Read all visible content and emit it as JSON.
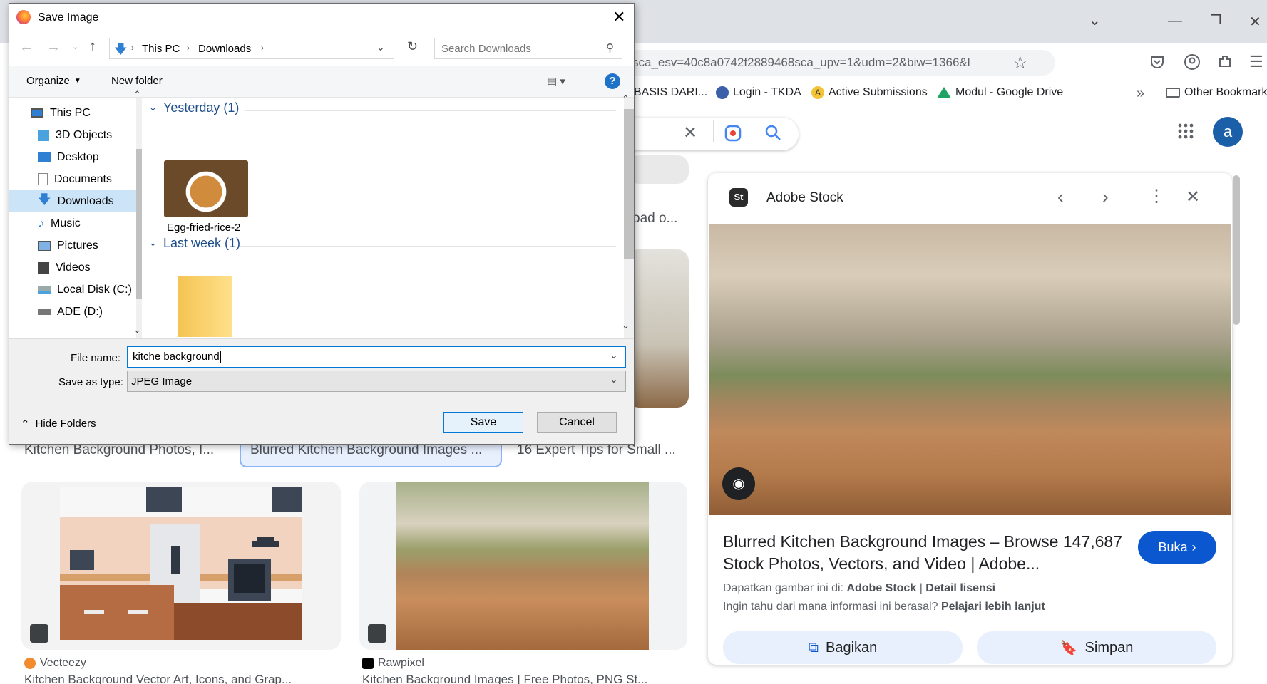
{
  "browser": {
    "url": "sca_esv=40c8a0742f2889468sca_upv=1&udm=2&biw=1366&l",
    "bookmarks": [
      {
        "label": "BASIS DARI..."
      },
      {
        "label": "Login - TKDA"
      },
      {
        "label": "Active Submissions"
      },
      {
        "label": "Modul - Google Drive"
      },
      {
        "label": "Other Bookmarks"
      }
    ],
    "avatar_letter": "a"
  },
  "results": {
    "top_partial_caption": "oad o...",
    "captions": [
      "Kitchen Background Photos, I...",
      "Blurred Kitchen Background Images ...",
      "16 Expert Tips for Small ..."
    ],
    "sources": [
      {
        "name": "Vecteezy",
        "title": "Kitchen Background Vector Art, Icons, and Grap..."
      },
      {
        "name": "Rawpixel",
        "title": "Kitchen Background Images | Free Photos, PNG St..."
      }
    ]
  },
  "side_panel": {
    "site_name": "Adobe Stock",
    "site_badge": "St",
    "title": "Blurred Kitchen Background Images – Browse 147,687 Stock Photos, Vectors, and Video | Adobe...",
    "open_label": "Buka",
    "get_image_prefix": "Dapatkan gambar ini di:",
    "get_image_source": "Adobe Stock",
    "license_link": "Detail lisensi",
    "info_question": "Ingin tahu dari mana informasi ini berasal?",
    "learn_more": "Pelajari lebih lanjut",
    "share_label": "Bagikan",
    "save_label": "Simpan"
  },
  "dialog": {
    "title": "Save Image",
    "breadcrumb": [
      "This PC",
      "Downloads"
    ],
    "search_placeholder": "Search Downloads",
    "organize_label": "Organize",
    "new_folder_label": "New folder",
    "nav_items": [
      {
        "label": "This PC",
        "icon": "pc-icon"
      },
      {
        "label": "3D Objects",
        "icon": "cube-icon"
      },
      {
        "label": "Desktop",
        "icon": "desktop-icon"
      },
      {
        "label": "Documents",
        "icon": "documents-icon"
      },
      {
        "label": "Downloads",
        "icon": "download-icon"
      },
      {
        "label": "Music",
        "icon": "music-icon"
      },
      {
        "label": "Pictures",
        "icon": "pictures-icon"
      },
      {
        "label": "Videos",
        "icon": "videos-icon"
      },
      {
        "label": "Local Disk (C:)",
        "icon": "disk-icon"
      },
      {
        "label": "ADE (D:)",
        "icon": "drive-icon"
      }
    ],
    "groups": [
      {
        "label": "Yesterday (1)",
        "file": "Egg-fried-rice-2"
      },
      {
        "label": "Last week (1)",
        "file": ""
      }
    ],
    "file_name_label": "File name:",
    "file_name_value": "kitche background",
    "save_type_label": "Save as type:",
    "save_type_value": "JPEG Image",
    "hide_folders_label": "Hide Folders",
    "save_button": "Save",
    "cancel_button": "Cancel"
  }
}
